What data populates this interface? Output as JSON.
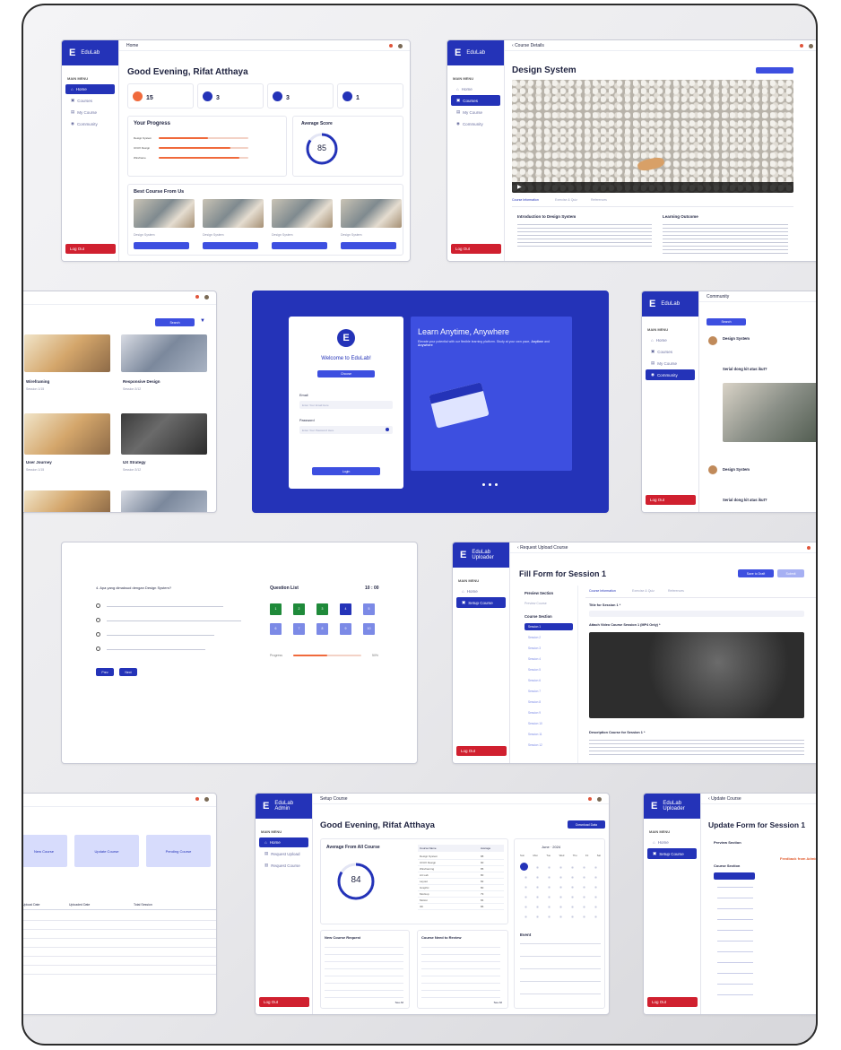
{
  "brand": "EduLab",
  "brand_uploader": [
    "EduLab",
    "Uploader"
  ],
  "brand_admin": [
    "EduLab",
    "Admin"
  ],
  "menu_title": "MAIN MENU",
  "logout": "Log Out",
  "nav_main": [
    "Home",
    "Courses",
    "My Course",
    "Community"
  ],
  "greeting": "Good Evening, Rifat Atthaya",
  "dashboard": {
    "home_tab": "Home",
    "stats": [
      {
        "num": "15"
      },
      {
        "num": "3"
      },
      {
        "num": "3"
      },
      {
        "num": "1"
      }
    ],
    "progress_title": "Your Progress",
    "progress_rows": [
      {
        "label": "Design System",
        "progress": 0.55
      },
      {
        "label": "UI/UX Design",
        "progress": 0.8
      },
      {
        "label": "Wireframe",
        "progress": 0.9
      }
    ],
    "avg_title": "Average Score",
    "avg_value": "85",
    "avg_progress": 0.85,
    "best_title": "Best Course From Us",
    "course_cards": [
      "Design System",
      "Design System",
      "Design System",
      "Design System"
    ]
  },
  "course_detail": {
    "back": "Course Details",
    "title": "Design System",
    "tabs": [
      "Course Information",
      "Exercise & Quiz",
      "References"
    ],
    "intro_title": "Introduction to Design System",
    "outcome_title": "Learning Outcome"
  },
  "courses_list": {
    "search_button": "Search",
    "items": [
      {
        "name": "Wireframing",
        "session": "Session 1/15"
      },
      {
        "name": "Responsive Design",
        "session": "Session 3/12"
      },
      {
        "name": "User Journey",
        "session": "Session 1/15"
      },
      {
        "name": "UX Strategy",
        "session": "Session 3/12"
      }
    ]
  },
  "login": {
    "welcome": "Welcome to EduLab!",
    "role": "Choose",
    "email_label": "Email",
    "email_placeholder": "Enter Your Email Here",
    "password_label": "Password",
    "password_placeholder": "Enter Your Password Here",
    "button": "Login",
    "hero_title": "Learn Anytime, Anywhere",
    "hero_pre": "Elevate your potential with our flexible learning platform.",
    "hero_mid": "Study at your own pace,",
    "hero_em1": "Anytime",
    "hero_and": "and",
    "hero_em2": "Anywhere"
  },
  "community": {
    "title": "Community",
    "search_button": "Search",
    "posts": [
      {
        "title": "Design System"
      },
      {
        "title": "Serial dong kit atas ikut?"
      },
      {
        "title": "Design System"
      },
      {
        "title": "Serial dong kit atas ikut?"
      }
    ]
  },
  "quiz": {
    "question": "4. Apa yang dimaksud dengan Design System?",
    "options": [
      "",
      "",
      "",
      ""
    ],
    "list_title": "Question List",
    "timer": "10 : 00",
    "numbers": [
      "1",
      "2",
      "3",
      "4",
      "5",
      "6",
      "7",
      "8",
      "9",
      "10"
    ],
    "progress_label": "Progress",
    "progress_value": "50%",
    "progress": 0.5,
    "prev": "Prev",
    "next": "Next"
  },
  "upload": {
    "back": "Request Upload Course",
    "title": "Fill Form for Session 1",
    "save_draft": "Save to Draft",
    "submit": "Submit",
    "preview_section": "Preview Section",
    "preview_course": "Preview Course",
    "course_section": "Course Section",
    "sessions": [
      "Session 1",
      "Session 2",
      "Session 3",
      "Session 4",
      "Session 5",
      "Session 6",
      "Session 7",
      "Session 8",
      "Session 9",
      "Session 10",
      "Session 11",
      "Session 12"
    ],
    "tabs": [
      "Course Information",
      "Exercise & Quiz",
      "References"
    ],
    "title_field_label": "Title for Session 1 *",
    "video_label": "Attach Video Course Session 1 (MP4 Only) *",
    "desc_label": "Description Course for Session 1 *",
    "nav": [
      "Home",
      "Setup Course"
    ]
  },
  "table_screen": {
    "pills": [
      "New Course",
      "Update Course",
      "Pending Course"
    ],
    "cols": [
      "Upload Date",
      "Uploaded Date",
      "Total Session"
    ]
  },
  "admin": {
    "top": "Setup Course",
    "download": "Download Data",
    "avg_title": "Average From All Course",
    "avg_value": "84",
    "avg_progress": 0.84,
    "course_col": "Course Name",
    "score_col": "Average",
    "courses": [
      {
        "name": "Design System",
        "score": "88"
      },
      {
        "name": "UI/UX Design",
        "score": "90"
      },
      {
        "name": "Wireframing",
        "score": "85"
      },
      {
        "name": "Art Lab",
        "score": "80"
      },
      {
        "name": "Layout",
        "score": "82"
      },
      {
        "name": "Graphic",
        "score": "80"
      },
      {
        "name": "Mockup",
        "score": "79"
      },
      {
        "name": "Motion",
        "score": "84"
      },
      {
        "name": "3D",
        "score": "86"
      }
    ],
    "calendar_month": "June",
    "calendar_year": "2024",
    "weekdays": [
      "Sun",
      "Mon",
      "Tue",
      "Wed",
      "Thu",
      "Fri",
      "Sat"
    ],
    "event_title": "Event",
    "new_request_title": "New Course Request",
    "review_title": "Course Need to Review",
    "see_all": "See All",
    "nav": [
      "Home",
      "Request Upload",
      "Request Course"
    ]
  },
  "update": {
    "back": "Update Course",
    "title": "Update Form for Session 1",
    "preview_section": "Preview Section",
    "course_section": "Course Section",
    "feedback_title": "Feedback from Admin",
    "nav": [
      "Home",
      "Setup Course"
    ]
  },
  "colors": {
    "primary": "#2433b8",
    "danger": "#d0202f",
    "accent": "#f06a3c",
    "quiz_answered": "#1f8a3a"
  }
}
